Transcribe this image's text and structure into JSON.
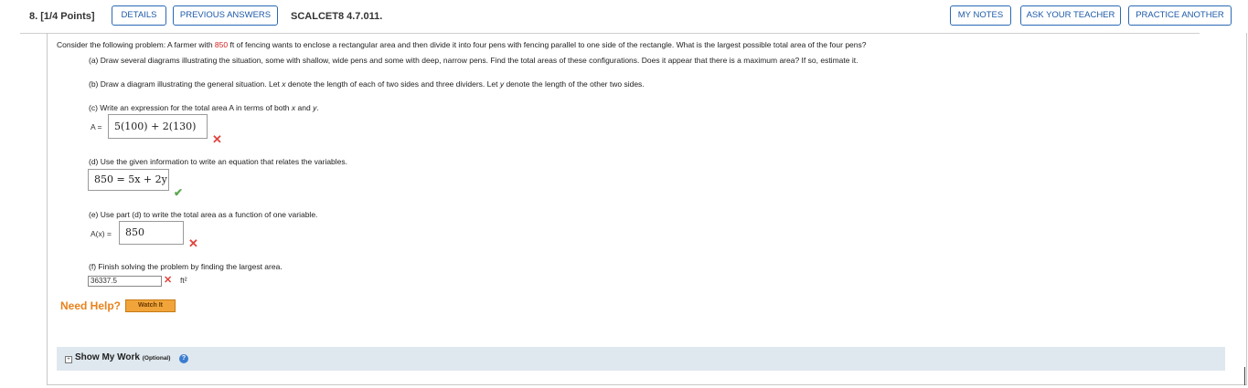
{
  "header": {
    "question_label": "8.  [1/4 Points]",
    "details": "DETAILS",
    "previous_answers": "PREVIOUS ANSWERS",
    "problem_code": "SCALCET8 4.7.011.",
    "my_notes": "MY NOTES",
    "ask_teacher": "ASK YOUR TEACHER",
    "practice_another": "PRACTICE ANOTHER"
  },
  "problem": {
    "intro_pre": "Consider the following problem: A farmer with ",
    "intro_value": "850",
    "intro_post": " ft of fencing wants to enclose a rectangular area and then divide it into four pens with fencing parallel to one side of the rectangle. What is the largest possible total area of the four pens?",
    "part_a": "(a) Draw several diagrams illustrating the situation, some with shallow, wide pens and some with deep, narrow pens. Find the total areas of these configurations. Does it appear that there is a maximum area? If so, estimate it.",
    "part_b_1": "(b) Draw a diagram illustrating the general situation. Let ",
    "part_b_x": "x",
    "part_b_2": " denote the length of each of two sides and three dividers. Let ",
    "part_b_y": "y",
    "part_b_3": " denote the length of the other two sides.",
    "part_c_1": "(c) Write an expression for the total area A in terms of both ",
    "part_c_x": "x",
    "part_c_2": " and ",
    "part_c_y": "y",
    "part_c_3": ".",
    "part_c_label": "A =",
    "part_c_answer": "5(100) + 2(130)",
    "part_d": "(d) Use the given information to write an equation that relates the variables.",
    "part_d_answer": "850 = 5x + 2y",
    "part_e": "(e) Use part (d) to write the total area as a function of one variable.",
    "part_e_label": "A(x) =",
    "part_e_answer": "850",
    "part_f": "(f) Finish solving the problem by finding the largest area.",
    "part_f_answer": "36337.5",
    "part_f_unit": "ft²"
  },
  "help": {
    "need_help": "Need Help?",
    "watch_it": "Watch It"
  },
  "show_my_work": {
    "toggle": "+",
    "title": "Show My Work",
    "optional": "(Optional)",
    "help_icon": "?"
  },
  "marks": {
    "incorrect": "✕",
    "correct": "✔"
  },
  "colors": {
    "accent_blue": "#1d5aa8",
    "incorrect_red": "#e0443e",
    "correct_green": "#5aa84e",
    "need_help_orange": "#e8821c",
    "panel_bg": "#dfe8ef"
  }
}
